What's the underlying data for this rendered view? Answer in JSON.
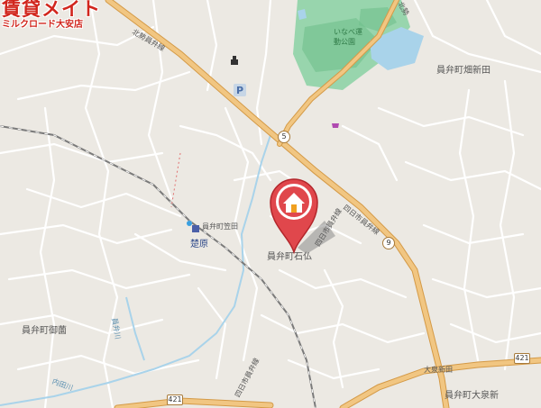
{
  "brand": {
    "name": "賃貸メイト",
    "branch": "ミルクロード大安店",
    "color": "#d1261d"
  },
  "map": {
    "place_labels": [
      {
        "id": "kusune",
        "text": "員弁町畑新田"
      },
      {
        "id": "park",
        "text": "いなべ運動公園"
      },
      {
        "id": "koto",
        "text": "員弁町笠田"
      },
      {
        "id": "chochi",
        "text": "員弁町御薗"
      },
      {
        "id": "south",
        "text": "員弁町大泉新"
      },
      {
        "id": "target",
        "text": "員弁町石仏"
      }
    ],
    "road_labels": [
      {
        "id": "north-road",
        "text": "北勢員弁線"
      },
      {
        "id": "yokkaichi",
        "text": "四日市員弁線"
      },
      {
        "id": "ne-road",
        "text": "北勢"
      },
      {
        "id": "east-sub",
        "text": "四日市員弁線"
      },
      {
        "id": "south-sub",
        "text": "四日市員弁線"
      },
      {
        "id": "kasai",
        "text": "大泉新田"
      }
    ],
    "river_labels": [
      {
        "id": "river1",
        "text": "員弁川"
      },
      {
        "id": "river2",
        "text": "内田川"
      }
    ],
    "station": {
      "text": "楚原"
    },
    "routes": [
      {
        "id": "r5",
        "text": "5"
      },
      {
        "id": "r9",
        "text": "9"
      },
      {
        "id": "r421a",
        "text": "421"
      },
      {
        "id": "r421b",
        "text": "421"
      }
    ],
    "parking_label": "P",
    "marker_icon": "home-marker-icon",
    "colors": {
      "land": "#ece9e3",
      "road_major": "#f1c682",
      "road_minor": "#ffffff",
      "water": "#a9d3ea",
      "park": "#8fd3a6",
      "rail": "#7a7a7a",
      "marker": "#e0474c"
    }
  }
}
